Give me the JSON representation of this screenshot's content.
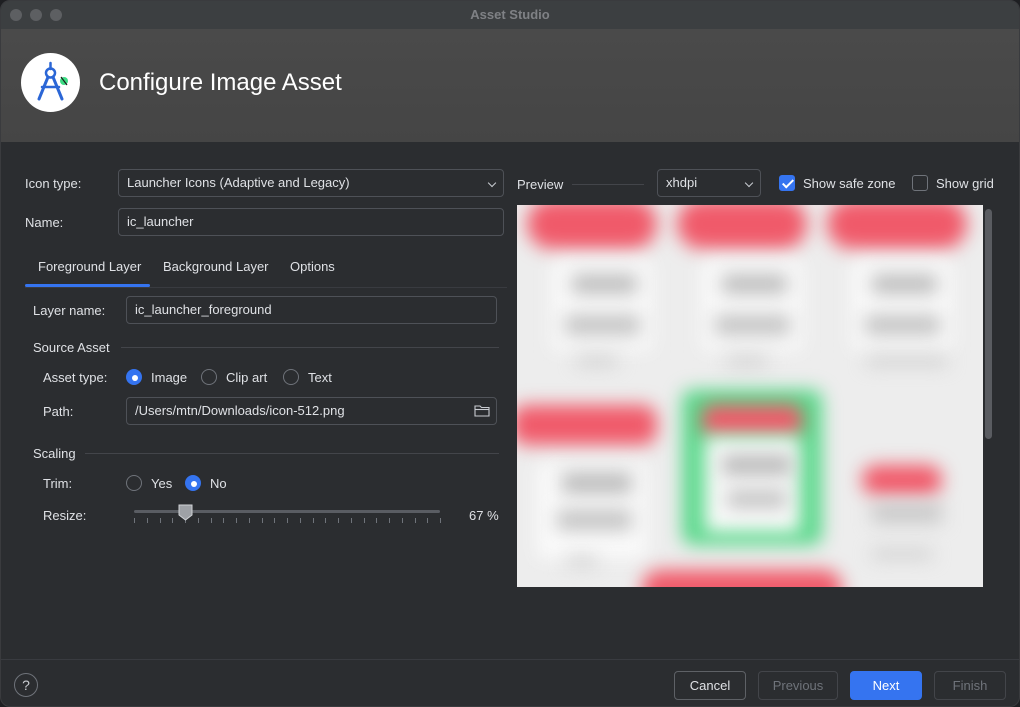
{
  "window": {
    "title": "Asset Studio"
  },
  "banner": {
    "title": "Configure Image Asset"
  },
  "form": {
    "icon_type_label": "Icon type:",
    "icon_type_value": "Launcher Icons (Adaptive and Legacy)",
    "name_label": "Name:",
    "name_value": "ic_launcher"
  },
  "tabs": [
    {
      "label": "Foreground Layer",
      "selected": true
    },
    {
      "label": "Background Layer",
      "selected": false
    },
    {
      "label": "Options",
      "selected": false
    }
  ],
  "layer": {
    "layer_name_label": "Layer name:",
    "layer_name_value": "ic_launcher_foreground",
    "source_asset_title": "Source Asset",
    "asset_type_label": "Asset type:",
    "asset_type_options": [
      {
        "label": "Image",
        "selected": true
      },
      {
        "label": "Clip art",
        "selected": false
      },
      {
        "label": "Text",
        "selected": false
      }
    ],
    "path_label": "Path:",
    "path_value": "/Users/mtn/Downloads/icon-512.png",
    "scaling_title": "Scaling",
    "trim_label": "Trim:",
    "trim_options": [
      {
        "label": "Yes",
        "selected": false
      },
      {
        "label": "No",
        "selected": true
      }
    ],
    "resize_label": "Resize:",
    "resize_percent": 67,
    "resize_value_text": "67 %"
  },
  "preview": {
    "label": "Preview",
    "density_value": "xhdpi",
    "show_safe_zone_label": "Show safe zone",
    "show_safe_zone_checked": true,
    "show_grid_label": "Show grid",
    "show_grid_checked": false
  },
  "footer": {
    "help_label": "?",
    "cancel_label": "Cancel",
    "previous_label": "Previous",
    "next_label": "Next",
    "finish_label": "Finish"
  },
  "colors": {
    "accent": "#3574f0",
    "background": "#2b2d30",
    "banner": "#474747"
  }
}
